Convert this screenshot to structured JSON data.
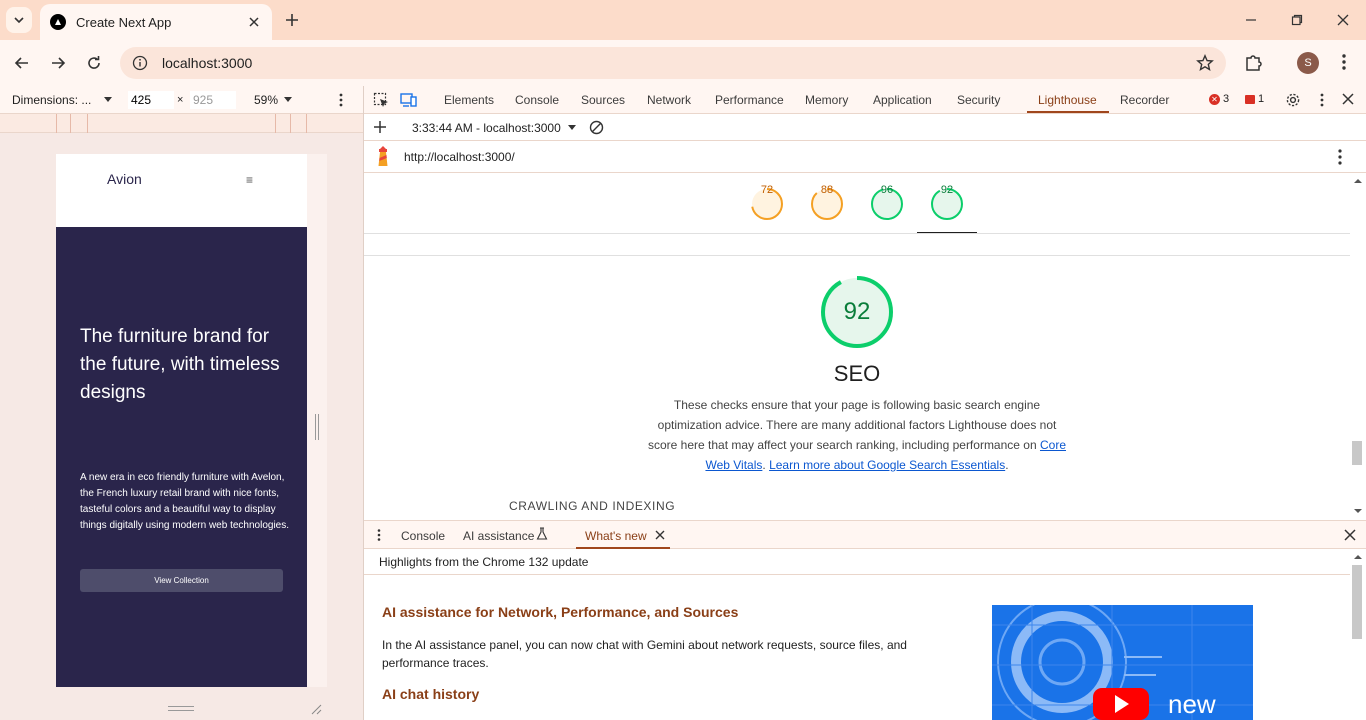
{
  "browser": {
    "tab_title": "Create Next App",
    "url": "localhost:3000",
    "profile_initial": "S"
  },
  "device_toolbar": {
    "dimensions_label": "Dimensions: ...",
    "width": "425",
    "height": "925",
    "zoom": "59%"
  },
  "page": {
    "brand": "Avion",
    "menu_glyph": "≡",
    "hero_title": "The furniture brand for the future, with timeless designs",
    "hero_text": "A new era in eco friendly furniture with Avelon, the French luxury retail brand with nice fonts, tasteful colors and a beautiful way to display things digitally using modern web technologies.",
    "hero_button": "View Collection"
  },
  "devtools": {
    "tabs": [
      "Elements",
      "Console",
      "Sources",
      "Network",
      "Performance",
      "Memory",
      "Application",
      "Security",
      "Lighthouse",
      "Recorder"
    ],
    "active_tab": "Lighthouse",
    "error_count": "3",
    "issue_count": "1",
    "lighthouse": {
      "report_time": "3:33:44 AM - localhost:3000",
      "report_url": "http://localhost:3000/",
      "scores": [
        {
          "value": "72",
          "color": "#f4a024"
        },
        {
          "value": "88",
          "color": "#f4a024"
        },
        {
          "value": "96",
          "color": "#0cce6b"
        },
        {
          "value": "92",
          "color": "#0cce6b"
        }
      ],
      "main_score": "92",
      "category": "SEO",
      "description": "These checks ensure that your page is following basic search engine optimization advice. There are many additional factors Lighthouse does not score here that may affect your search ranking, including performance on",
      "link1": "Core Web Vitals",
      "sep": ".",
      "link2": "Learn more about Google Search Essentials",
      "end": ".",
      "section": "CRAWLING AND INDEXING"
    },
    "drawer": {
      "tabs": [
        "Console",
        "AI assistance",
        "What's new"
      ],
      "active": "What's new",
      "header": "Highlights from the Chrome 132 update",
      "h1": "AI assistance for Network, Performance, and Sources",
      "p1": "In the AI assistance panel, you can now chat with Gemini about network requests, source files, and performance traces.",
      "h2": "AI chat history",
      "video_word": "new"
    }
  }
}
